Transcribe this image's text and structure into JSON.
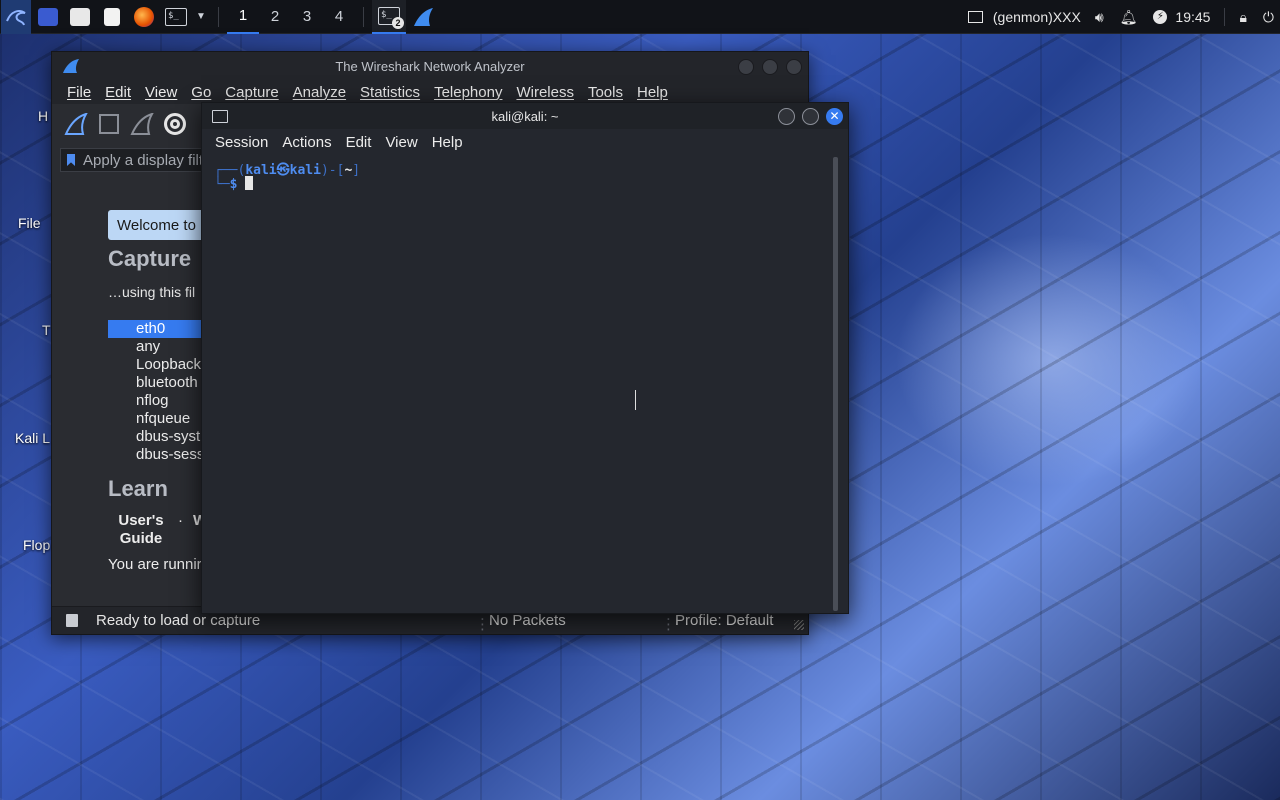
{
  "panel": {
    "workspaces": [
      "1",
      "2",
      "3",
      "4"
    ],
    "active_workspace": "1",
    "terminal_badge": "2",
    "genmon": "(genmon)XXX",
    "clock": "19:45",
    "accent": "#367bf0"
  },
  "desktop": {
    "icons": [
      "File",
      "T",
      "Kali L",
      "Flop"
    ]
  },
  "wireshark": {
    "title": "The Wireshark Network Analyzer",
    "menu": [
      "File",
      "Edit",
      "View",
      "Go",
      "Capture",
      "Analyze",
      "Statistics",
      "Telephony",
      "Wireless",
      "Tools",
      "Help"
    ],
    "filter_placeholder": "Apply a display filt",
    "welcome": "Welcome to",
    "capture_heading": "Capture",
    "capture_sub": "…using this fil",
    "interfaces": [
      "eth0",
      "any",
      "Loopback",
      "bluetooth",
      "nflog",
      "nfqueue",
      "dbus-syst",
      "dbus-sess"
    ],
    "learn_heading": "Learn",
    "users_guide": "User's Guide",
    "dot": "·",
    "wiki": "W",
    "running": "You are runnir",
    "status_ready": "Ready to load or capture",
    "status_packets": "No Packets",
    "status_profile": "Profile: Default"
  },
  "terminal": {
    "title": "kali@kali: ~",
    "menu": [
      "Session",
      "Actions",
      "Edit",
      "View",
      "Help"
    ],
    "prompt_user": "kali",
    "prompt_at": "㉿",
    "prompt_host": "kali",
    "prompt_dir": "~",
    "prompt_symbol": "$"
  }
}
